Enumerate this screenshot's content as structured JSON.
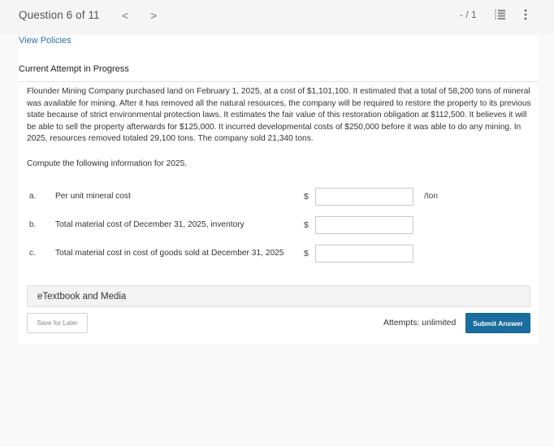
{
  "header": {
    "question_counter": "Question 6 of 11",
    "prev_icon": "chevron-left-icon",
    "next_icon": "chevron-right-icon",
    "prev_glyph": "<",
    "next_glyph": ">",
    "score": "- / 1",
    "list_icon": "list-icon",
    "more_icon": "more-vertical-icon"
  },
  "card": {
    "view_policies": "View Policies",
    "attempt_heading": "Current Attempt in Progress",
    "problem_text": "Flounder Mining Company purchased land on February 1, 2025, at a cost of $1,101,100. It estimated that a total of 58,200 tons of mineral was available for mining. After it has removed all the natural resources, the company will be required to restore the property to its previous state because of strict environmental protection laws. It estimates the fair value of this restoration obligation at $112,500. It believes it will be able to sell the property afterwards for $125,000. It incurred developmental costs of $250,000 before it was able to do any mining. In 2025, resources removed totaled 29,100 tons. The company sold 21,340 tons.",
    "prompt": "Compute the following information for 2025.",
    "rows": [
      {
        "letter": "a.",
        "label": "Per unit mineral cost",
        "currency": "$",
        "value": "",
        "unit": "/ton"
      },
      {
        "letter": "b.",
        "label": "Total material cost of December 31, 2025, inventory",
        "currency": "$",
        "value": "",
        "unit": ""
      },
      {
        "letter": "c.",
        "label": "Total material cost in cost of goods sold at December 31, 2025",
        "currency": "$",
        "value": "",
        "unit": ""
      }
    ],
    "etextbook_label": "eTextbook and Media",
    "save_later_label": "Save for Later",
    "attempts_text": "Attempts: unlimited",
    "submit_label": "Submit Answer"
  },
  "colors": {
    "accent": "#1a6e9f",
    "link": "#2a6fa8",
    "page_bg": "#f9f9f9",
    "header_bg": "#f5f5f5"
  }
}
